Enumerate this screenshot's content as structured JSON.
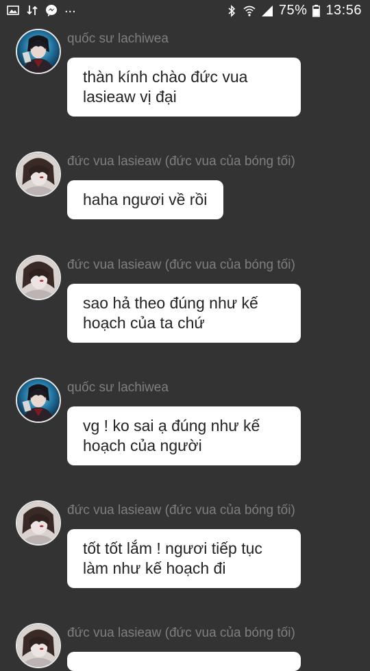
{
  "status_bar": {
    "left_icons": [
      "image-icon",
      "data-transfer-icon",
      "messenger-icon"
    ],
    "overflow": "...",
    "battery_percent": "75%",
    "time": "13:56",
    "right_icons": [
      "bluetooth-icon",
      "wifi-icon",
      "signal-icon",
      "battery-icon"
    ]
  },
  "messages": [
    {
      "sender": "quốc sư lachiwea",
      "avatar": "avatar-lachiwea",
      "text": "thàn kính chào đức vua lasieaw vị đại"
    },
    {
      "sender": "đức vua lasieaw (đức vua của bóng tối)",
      "avatar": "avatar-lasieaw",
      "text": "haha ngươi về rồi"
    },
    {
      "sender": "đức vua lasieaw (đức vua của bóng tối)",
      "avatar": "avatar-lasieaw",
      "text": "sao hả theo đúng như kế hoạch của ta chứ"
    },
    {
      "sender": "quốc sư lachiwea",
      "avatar": "avatar-lachiwea",
      "text": "vg ! ko sai ạ đúng như kế hoạch của người"
    },
    {
      "sender": "đức vua lasieaw (đức vua của bóng tối)",
      "avatar": "avatar-lasieaw",
      "text": "tốt tốt lắm ! ngươi tiếp tục làm như kế hoạch đi"
    },
    {
      "sender": "đức vua lasieaw (đức vua của bóng tối)",
      "avatar": "avatar-lasieaw",
      "text": ""
    }
  ]
}
